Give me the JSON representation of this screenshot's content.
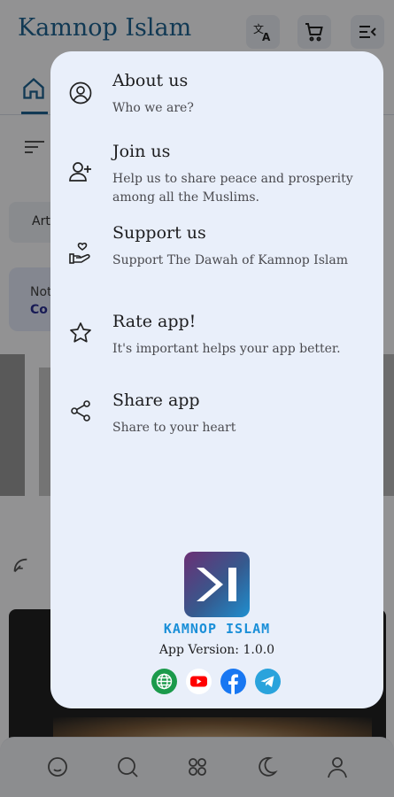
{
  "app": {
    "title": "Kamnop Islam",
    "chip_label": "Art",
    "notice_text": "Not",
    "notice_link": "Co"
  },
  "menu": {
    "items": [
      {
        "title": "About us",
        "subtitle": "Who we are?",
        "icon": "user-circle-icon"
      },
      {
        "title": "Join us",
        "subtitle": "Help us to share peace and prosperity among all the Muslims.",
        "icon": "user-add-icon"
      },
      {
        "title": "Support us",
        "subtitle": "Support The Dawah of Kamnop Islam",
        "icon": "hand-heart-icon"
      },
      {
        "title": "Rate app!",
        "subtitle": "It's important helps your app better.",
        "icon": "star-icon"
      },
      {
        "title": "Share app",
        "subtitle": "Share to your heart",
        "icon": "share-icon"
      }
    ],
    "brand": "KAMNOP ISLAM",
    "version": "App Version: 1.0.0",
    "socials": [
      "website",
      "youtube",
      "facebook",
      "telegram"
    ]
  },
  "colors": {
    "brand_blue": "#1e6391",
    "menu_bg": "#e9effa",
    "logo_text": "#1a8fd8"
  }
}
